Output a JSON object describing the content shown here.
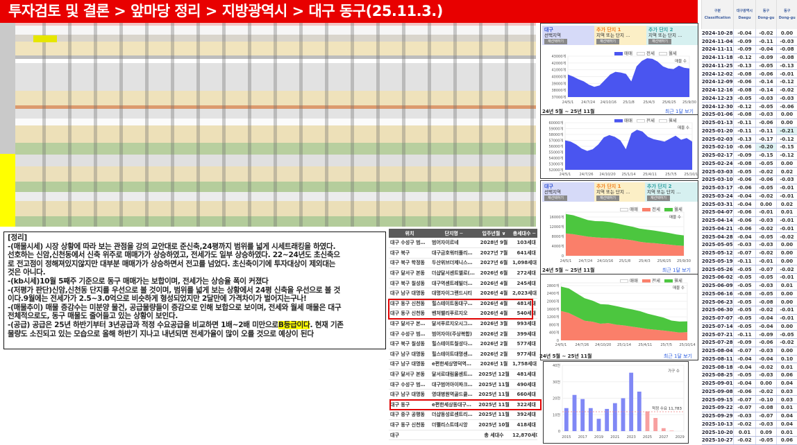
{
  "title": "투자검토 및 결론 > 앞마당 정리 > 지방광역시 > 대구 동구(25.11.3.)",
  "note": {
    "lines": [
      "[정리]",
      "-(매물시세) 시장 상황에 따라 보는 관점을 강의 교안대로 준신축,24평까지 범위를 넓게 시세트래킹을 하였다.",
      "선호하는 신암,신천동에서 신축 위주로 매매가가 상승하였고, 전세가도 일부 상승하였다. 22~24년도 초신축으",
      "로 전고점이 정해져있지않지만 대부분 매매가가 상승하면서 전고를 넘었다. 초신축이기에 투자대상이 제외대는",
      "것은 아니다.",
      "-(kb시세)10월 5째주 기준으로 동구 매매가는 보합이며, 전세가는 상승율 폭이 커졌다",
      "-(저평가 판단)신암,신천동 단지를 우선으로 볼 것이며, 범위를 넓게 보는 상황에서 24평 신축을 우선으로 볼 것",
      "이다.9월에는 전세가가 2.5~3.0억으로 비슷하게 형성되었지만 2달만에 가격차이가 벌어지는구나!",
      "-(매물추이) 매물 증감수는 미분양 물건, 공급물량들이 증감으로 인해 보합으로 보이며, 전세와 월세 매물은 대구",
      "전체적으로도, 동구 매물도 줄어들고 있는 상황이 보인다."
    ],
    "supply_line_a": "-(공급) 공급은 25년 하반기부터 3년공급과 적정 수요공급을 비교하면 1배~2배 미만으로",
    "supply_highlight": "B등급이다",
    "supply_line_b": ". 현재 기존",
    "last_line": "물량도 소진되고 있는 모습으로 올해 하반기 지나고 내년되면 전세가율이 많이 오를 것으로 예상이 된다"
  },
  "supply_table": {
    "headers": [
      "위치",
      "단지명 ─",
      "입주년월 ∨",
      "총세대수 ─"
    ],
    "rows": [
      [
        "대구 수성구 범…",
        "범어자이르네",
        "2028년 9월",
        "103세대"
      ],
      [
        "대구 북구",
        "대구금호워터폴리…",
        "2027년 7월",
        "641세대"
      ],
      [
        "대구 북구 학정동",
        "두산위브더제니스…",
        "2027년 6월",
        "1,098세대"
      ],
      [
        "대구 달서구 본동",
        "더샵달서센트엘로(…",
        "2026년 6월",
        "272세대"
      ],
      [
        "대구 북구 칠성동",
        "대구역센트레빌더…",
        "2026년 4월",
        "245세대"
      ],
      [
        "대구 남구 대명동",
        "대명자이그랜드시티",
        "2026년 4월",
        "2,023세대"
      ],
      [
        "대구 동구 신천동",
        "힐스테이트동대구…",
        "2026년 4월",
        "481세대"
      ],
      [
        "대구 동구 신천동",
        "벤처밸리푸르지오",
        "2026년 4월",
        "540세대"
      ],
      [
        "대구 달서구 본…",
        "달서푸르지오시그…",
        "2026년 3월",
        "993세대"
      ],
      [
        "대구 수성구 범…",
        "범어자이(주상복합)",
        "2026년 2월",
        "399세대"
      ],
      [
        "대구 북구 칠성동",
        "힐스테이트칠성다…",
        "2026년 2월",
        "577세대"
      ],
      [
        "대구 남구 대명동",
        "힐스테이트대명센…",
        "2026년 2월",
        "977세대"
      ],
      [
        "대구 남구 대명동",
        "e편한세상명덕역…",
        "2026년 1월",
        "1,758세대"
      ],
      [
        "대구 달서구 본동",
        "달서로대림울센트…",
        "2025년 12월",
        "481세대"
      ],
      [
        "대구 수성구 범…",
        "대구범어아이파크…",
        "2025년 11월",
        "490세대"
      ],
      [
        "대구 남구 대명동",
        "영대병원역골드클…",
        "2025년 11월",
        "660세대"
      ],
      [
        "대구 동구",
        "e편한세상동대구…",
        "2025년 11월",
        "322세대"
      ],
      [
        "대구 중구 공평동",
        "더샵동성로센트리…",
        "2025년 11월",
        "392세대"
      ],
      [
        "대구 동구 신천동",
        "더펠리스트데시앙",
        "2025년 10월",
        "418세대"
      ]
    ],
    "total": [
      "대구",
      "",
      "총 세대수",
      "12,870세대"
    ]
  },
  "panels": {
    "selectors": [
      {
        "title": "대구",
        "sub": "선택지역",
        "btn": "재선택하기",
        "color": "#d6daf8",
        "title_color": "#3050d0"
      },
      {
        "title": "추가 단지 1",
        "sub": "지역 또는 단지 …",
        "btn": "재선택하기",
        "color": "#fcefc6",
        "title_color": "#f08020"
      },
      {
        "title": "추가 단지 2",
        "sub": "지역 또는 단지 …",
        "btn": "재선택하기",
        "color": "#d6f0f0",
        "title_color": "#30a0a0"
      }
    ],
    "legend": [
      "매매",
      "전세",
      "월세"
    ],
    "count_label": "매물 수",
    "period": "24년 5월 ~ 25년 11월",
    "recent_link": "최근 1달 보기",
    "colors": {
      "sale": "#4a55f0",
      "jeonse": "#fa7f6a",
      "monthly": "#4cc63f",
      "bar": "#8088f5",
      "bar_future": "#f7a0a0"
    }
  },
  "chart_data": [
    {
      "type": "area",
      "title": "대구 매물 수 (매매)",
      "ylim": [
        37000,
        43000
      ],
      "yticks": [
        37000,
        38000,
        39000,
        40000,
        41000,
        42000,
        43000
      ],
      "tick_suffix": "개",
      "xticks": [
        "24/5/1",
        "24/7/24",
        "24/10/16",
        "25/1/8",
        "25/4/3",
        "25/6/25",
        "25/9/30"
      ],
      "series": [
        {
          "name": "매매",
          "values": [
            40300,
            40000,
            39600,
            39300,
            38800,
            38500,
            38700,
            39500,
            40300,
            40700,
            40600,
            40400,
            39300,
            41500,
            42300,
            42700,
            42600,
            42200,
            41500,
            41200,
            41100,
            41600,
            41300,
            41200
          ]
        }
      ]
    },
    {
      "type": "area",
      "title": "동구 매물 수 (매매)",
      "ylim": [
        52000,
        60000
      ],
      "yticks": [
        52000,
        53000,
        54000,
        55000,
        56000,
        57000,
        58000,
        59000,
        60000
      ],
      "tick_suffix": "개",
      "xticks": [
        "24/5/1",
        "24/7/26",
        "24/10/20",
        "25/1/14",
        "25/4/11",
        "25/7/5",
        "25/10/14"
      ],
      "series": [
        {
          "name": "매매",
          "values": [
            57000,
            56800,
            56300,
            55600,
            55200,
            55500,
            56300,
            57500,
            57900,
            57600,
            57000,
            55500,
            58200,
            58800,
            58500,
            57600,
            57200,
            57000,
            56800,
            57300,
            57800,
            57100,
            57400,
            56800
          ]
        }
      ]
    },
    {
      "type": "area",
      "stacked": true,
      "title": "대구 매물 수 (전세/월세)",
      "ylim": [
        0,
        18000
      ],
      "yticks": [
        0,
        4000,
        8000,
        12000,
        16000
      ],
      "tick_suffix": "개",
      "xticks": [
        "24/5/1",
        "24/7/24",
        "24/10/16",
        "25/1/8",
        "25/4/3",
        "25/6/25",
        "25/9/30"
      ],
      "series": [
        {
          "name": "전세",
          "values": [
            9200,
            8900,
            8400,
            7900,
            7600,
            7400,
            7300,
            7100,
            6800,
            6400,
            5800,
            5400,
            5200,
            4900,
            4600,
            4300,
            4100
          ]
        },
        {
          "name": "월세",
          "values": [
            8000,
            7800,
            7300,
            6800,
            6700,
            6800,
            6600,
            6200,
            5800,
            5600,
            5400,
            5400,
            5200,
            5000,
            4800,
            4500,
            4300
          ]
        }
      ]
    },
    {
      "type": "area",
      "stacked": true,
      "title": "동구 매물 수 (전세/월세)",
      "ylim": [
        0,
        2940
      ],
      "yticks": [
        0,
        400,
        800,
        1200,
        1600,
        2000,
        2400,
        2800
      ],
      "tick_suffix": "개",
      "xticks": [
        "24/5/1",
        "24/7/26",
        "24/10/20",
        "25/1/14",
        "25/4/11",
        "25/7/5",
        "25/10/14"
      ],
      "series": [
        {
          "name": "전세",
          "values": [
            1500,
            1400,
            1200,
            1000,
            950,
            850,
            880,
            800,
            760,
            700,
            640,
            580,
            540,
            500,
            450,
            400,
            420
          ]
        },
        {
          "name": "월세",
          "values": [
            1250,
            1250,
            1200,
            1150,
            1080,
            1000,
            950,
            950,
            900,
            880,
            850,
            780,
            720,
            660,
            560,
            560,
            550
          ]
        }
      ]
    },
    {
      "type": "bar",
      "title": "가구 수",
      "ylim": [
        0,
        40000
      ],
      "yticks": [
        0,
        10000,
        20000,
        30000,
        40000
      ],
      "ytick_labels": [
        "0",
        "10천",
        "20천",
        "30천",
        "40천"
      ],
      "categories": [
        2015,
        2016,
        2017,
        2018,
        2019,
        2020,
        2021,
        2022,
        2023,
        2024,
        2025,
        2026,
        2027,
        2028,
        2029
      ],
      "xtick_labels": [
        "2015",
        "2017",
        "2019",
        "2021",
        "2023",
        "2025",
        "2027",
        "2029"
      ],
      "values": [
        14000,
        22000,
        19500,
        14000,
        7500,
        13500,
        17000,
        20000,
        35500,
        24000,
        12000,
        8000,
        1800,
        300,
        0
      ],
      "future_from": 2025,
      "reference": {
        "value": 11783,
        "label": "적정 수요 11,783"
      }
    }
  ],
  "kb_table": {
    "headers": [
      {
        "ko": "구분",
        "en": "Classification"
      },
      {
        "ko": "대구광역시",
        "en": "Daegu"
      },
      {
        "ko": "동구",
        "en": "Dong-gu"
      },
      {
        "ko": "동구",
        "en": "Dong-gu"
      }
    ],
    "rows": [
      [
        "2024-10-28",
        "-0.04",
        "-0.02",
        "0.00"
      ],
      [
        "2024-11-04",
        "-0.09",
        "-0.11",
        "-0.03"
      ],
      [
        "2024-11-11",
        "-0.09",
        "-0.04",
        "-0.08"
      ],
      [
        "2024-11-18",
        "-0.12",
        "-0.09",
        "-0.08"
      ],
      [
        "2024-11-25",
        "-0.13",
        "-0.05",
        "-0.13"
      ],
      [
        "2024-12-02",
        "-0.08",
        "-0.06",
        "-0.01"
      ],
      [
        "2024-12-09",
        "-0.06",
        "-0.14",
        "-0.12"
      ],
      [
        "2024-12-16",
        "-0.08",
        "-0.14",
        "-0.02"
      ],
      [
        "2024-12-23",
        "-0.05",
        "-0.03",
        "-0.03"
      ],
      [
        "2024-12-30",
        "-0.12",
        "-0.05",
        "-0.06"
      ],
      [
        "2025-01-06",
        "-0.08",
        "-0.03",
        "0.00"
      ],
      [
        "2025-01-13",
        "-0.11",
        "-0.06",
        "0.00"
      ],
      [
        "2025-01-20",
        "-0.11",
        "-0.11",
        "-0.21"
      ],
      [
        "2025-02-03",
        "-0.13",
        "-0.17",
        "-0.12"
      ],
      [
        "2025-02-10",
        "-0.06",
        "-0.20",
        "-0.15"
      ],
      [
        "2025-02-17",
        "-0.09",
        "-0.15",
        "-0.12"
      ],
      [
        "2025-02-24",
        "-0.08",
        "-0.05",
        "0.00"
      ],
      [
        "2025-03-03",
        "-0.05",
        "-0.02",
        "0.02"
      ],
      [
        "2025-03-10",
        "-0.06",
        "-0.06",
        "-0.03"
      ],
      [
        "2025-03-17",
        "-0.06",
        "-0.05",
        "-0.01"
      ],
      [
        "2025-03-24",
        "-0.04",
        "-0.02",
        "-0.01"
      ],
      [
        "2025-03-31",
        "-0.04",
        "0.00",
        "0.02"
      ],
      [
        "2025-04-07",
        "-0.06",
        "-0.01",
        "0.01"
      ],
      [
        "2025-04-14",
        "-0.06",
        "-0.03",
        "-0.01"
      ],
      [
        "2025-04-21",
        "-0.06",
        "-0.02",
        "-0.01"
      ],
      [
        "2025-04-28",
        "-0.04",
        "-0.05",
        "-0.02"
      ],
      [
        "2025-05-05",
        "-0.03",
        "-0.03",
        "0.00"
      ],
      [
        "2025-05-12",
        "-0.07",
        "-0.02",
        "0.00"
      ],
      [
        "2025-05-19",
        "-0.11",
        "-0.01",
        "0.00"
      ],
      [
        "2025-05-26",
        "-0.05",
        "-0.07",
        "-0.02"
      ],
      [
        "2025-06-02",
        "-0.05",
        "-0.05",
        "-0.01"
      ],
      [
        "2025-06-09",
        "-0.05",
        "-0.03",
        "0.01"
      ],
      [
        "2025-06-16",
        "-0.08",
        "-0.05",
        "0.00"
      ],
      [
        "2025-06-23",
        "-0.05",
        "-0.08",
        "0.00"
      ],
      [
        "2025-06-30",
        "-0.05",
        "-0.02",
        "-0.01"
      ],
      [
        "2025-07-07",
        "-0.05",
        "-0.04",
        "-0.01"
      ],
      [
        "2025-07-14",
        "-0.05",
        "-0.04",
        "0.00"
      ],
      [
        "2025-07-21",
        "-0.11",
        "-0.09",
        "-0.05"
      ],
      [
        "2025-07-28",
        "-0.09",
        "-0.06",
        "-0.02"
      ],
      [
        "2025-08-04",
        "-0.07",
        "-0.03",
        "0.00"
      ],
      [
        "2025-08-11",
        "-0.04",
        "-0.04",
        "0.10"
      ],
      [
        "2025-08-18",
        "-0.04",
        "-0.02",
        "0.01"
      ],
      [
        "2025-08-25",
        "-0.05",
        "-0.03",
        "0.06"
      ],
      [
        "2025-09-01",
        "-0.04",
        "0.00",
        "0.04"
      ],
      [
        "2025-09-08",
        "-0.06",
        "-0.02",
        "0.03"
      ],
      [
        "2025-09-15",
        "-0.07",
        "-0.10",
        "0.03"
      ],
      [
        "2025-09-22",
        "-0.07",
        "-0.08",
        "0.01"
      ],
      [
        "2025-09-29",
        "-0.03",
        "-0.07",
        "0.04"
      ],
      [
        "2025-10-13",
        "-0.02",
        "-0.03",
        "0.04"
      ],
      [
        "2025-10-20",
        "0.01",
        "0.09",
        "0.01"
      ],
      [
        "2025-10-27",
        "-0.02",
        "-0.05",
        "0.06"
      ]
    ],
    "highlighted_cells": [
      [
        12,
        3
      ],
      [
        14,
        2
      ]
    ]
  }
}
